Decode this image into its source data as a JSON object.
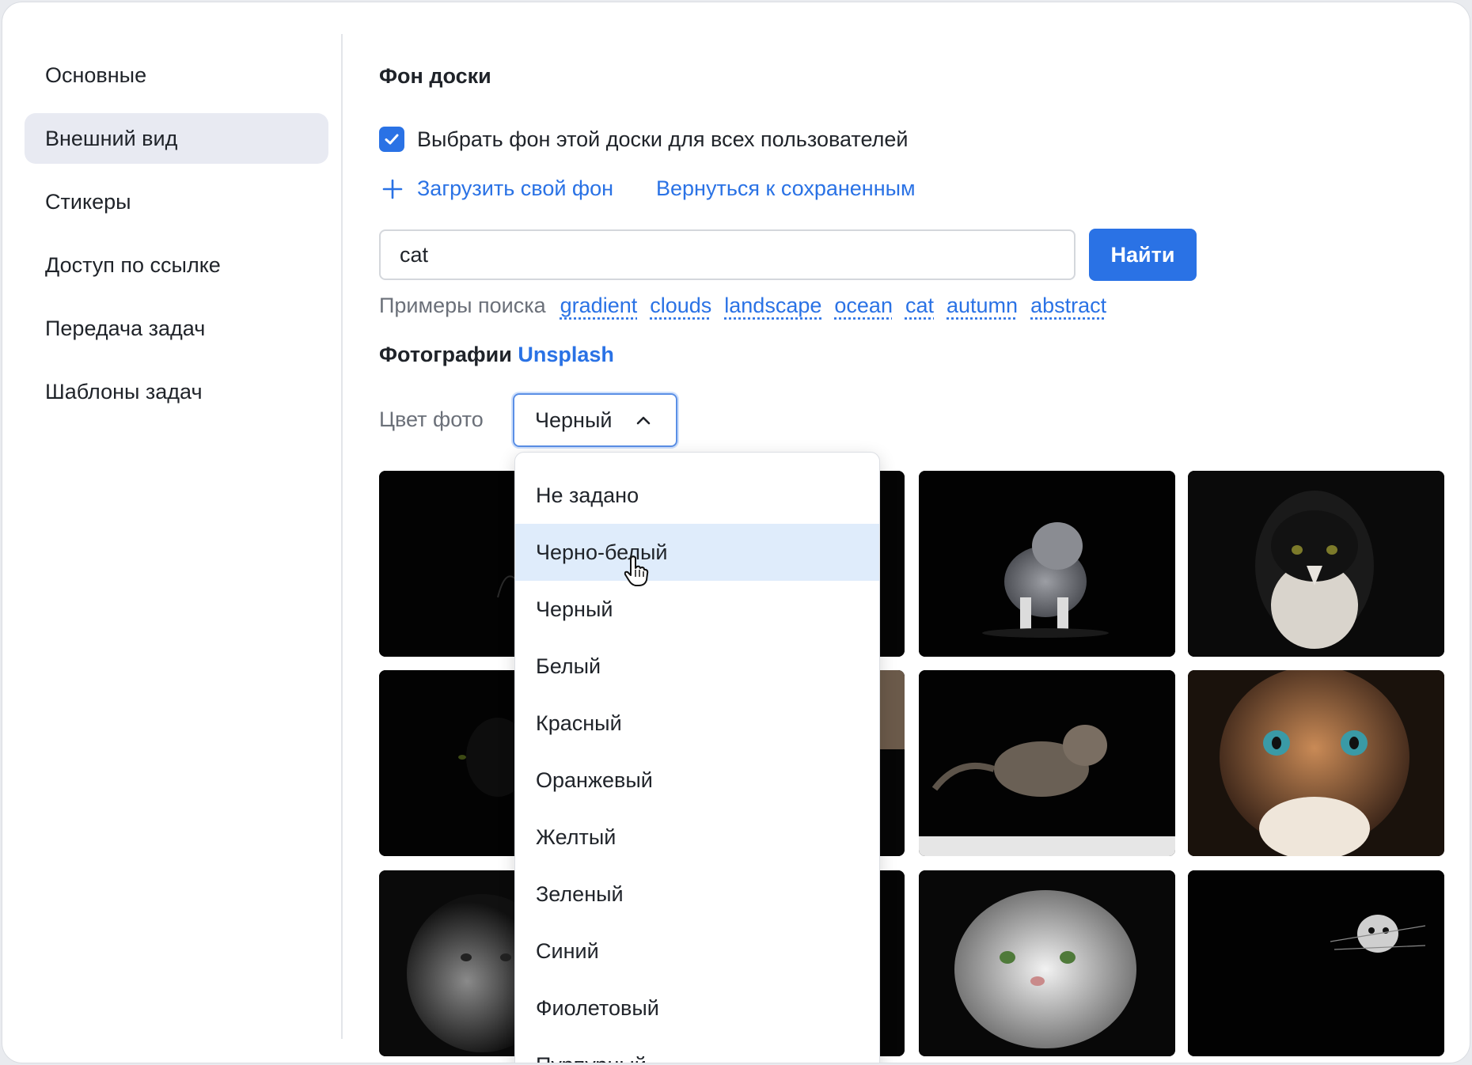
{
  "sidebar": {
    "items": [
      {
        "label": "Основные"
      },
      {
        "label": "Внешний вид",
        "active": true
      },
      {
        "label": "Стикеры"
      },
      {
        "label": "Доступ по ссылке"
      },
      {
        "label": "Передача задач"
      },
      {
        "label": "Шаблоны задач"
      }
    ]
  },
  "main": {
    "section_title": "Фон доски",
    "checkbox": {
      "label": "Выбрать фон этой доски для всех пользователей",
      "checked": true
    },
    "upload_label": "Загрузить свой фон",
    "revert_label": "Вернуться к сохраненным",
    "search": {
      "value": "cat",
      "button_label": "Найти"
    },
    "examples": {
      "label": "Примеры поиска",
      "items": [
        "gradient",
        "clouds",
        "landscape",
        "ocean",
        "cat",
        "autumn",
        "abstract"
      ]
    },
    "photos": {
      "title": "Фотографии",
      "brand": "Unsplash"
    },
    "color_filter": {
      "label": "Цвет фото",
      "selected": "Черный",
      "options": [
        "Не задано",
        "Черно-белый",
        "Черный",
        "Белый",
        "Красный",
        "Оранжевый",
        "Желтый",
        "Зеленый",
        "Синий",
        "Фиолетовый",
        "Пурпурный"
      ],
      "hovered": "Черно-белый"
    }
  },
  "colors": {
    "accent": "#2a72e5",
    "hover": "#dfecfb",
    "sidebar_active": "#e8eaf2"
  },
  "icons": [
    "check-icon",
    "plus-icon",
    "chevron-up-icon",
    "hand-cursor-icon"
  ]
}
